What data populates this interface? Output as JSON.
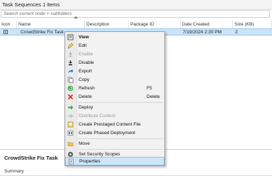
{
  "header": {
    "title": "Task Sequences 1 items"
  },
  "search": {
    "placeholder": "Search current node + subfolders"
  },
  "columns": [
    "Icon",
    "Name",
    "Description",
    "Package ID",
    "Date Created",
    "Size (KB)"
  ],
  "row": {
    "name": "CrowdStrike Fix Task",
    "package_id": "",
    "date_created": "7/19/2024 2:30 PM",
    "size": "2"
  },
  "context_menu": {
    "items": [
      {
        "label": "View",
        "icon": "view-icon",
        "bold": true
      },
      {
        "label": "Edit",
        "icon": "edit-icon"
      },
      {
        "label": "Enable",
        "icon": "enable-icon",
        "disabled": true
      },
      {
        "label": "Disable",
        "icon": "disable-icon"
      },
      {
        "label": "Export",
        "icon": "export-icon"
      },
      {
        "label": "Copy",
        "icon": "copy-icon"
      },
      {
        "label": "Refresh",
        "icon": "refresh-icon",
        "shortcut": "F5"
      },
      {
        "label": "Delete",
        "icon": "delete-icon",
        "shortcut": "Delete"
      },
      {
        "label": "Deploy",
        "icon": "deploy-icon"
      },
      {
        "label": "Distribute Content",
        "icon": "distribute-icon",
        "disabled": true
      },
      {
        "label": "Create Prestaged Content File",
        "icon": "prestaged-icon"
      },
      {
        "label": "Create Phased Deployment",
        "icon": "phased-icon"
      },
      {
        "label": "Move",
        "icon": "move-icon"
      },
      {
        "label": "Set Security Scopes",
        "icon": "security-scopes-icon"
      },
      {
        "label": "Properties",
        "icon": "properties-icon"
      }
    ]
  },
  "details": {
    "title": "CrowdStrike Fix Task",
    "summary": "Summary"
  },
  "colors": {
    "selection": "#cce4f7",
    "menu_bg": "#f2f2f2",
    "highlight": "#cde6f7"
  }
}
